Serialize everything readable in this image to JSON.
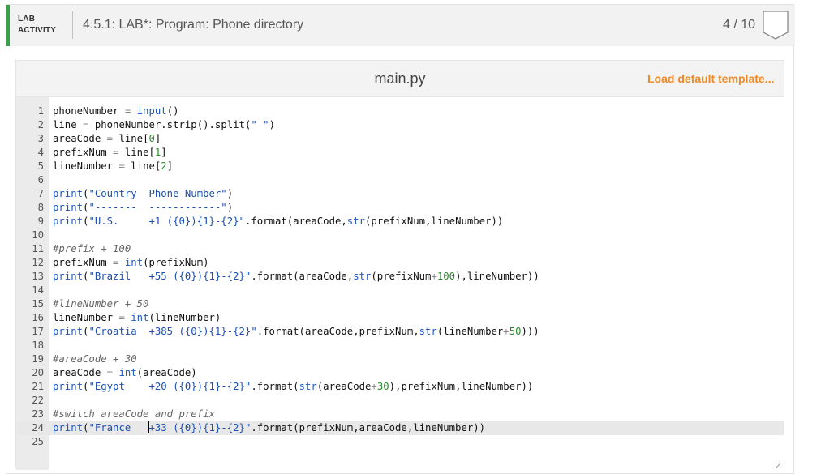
{
  "lab": {
    "tag_line1": "LAB",
    "tag_line2": "ACTIVITY",
    "title": "4.5.1: LAB*: Program: Phone directory",
    "score": "4 / 10",
    "accent_color": "#3a9e4a"
  },
  "editor": {
    "file_name": "main.py",
    "load_template_label": "Load default template...",
    "load_template_color": "#f08a24",
    "active_line": 24,
    "lines": [
      {
        "n": "1",
        "t": [
          [
            "var",
            "phoneNumber"
          ],
          [
            "op",
            " = "
          ],
          [
            "kw",
            "input"
          ],
          [
            "pun",
            "()"
          ]
        ]
      },
      {
        "n": "2",
        "t": [
          [
            "var",
            "line"
          ],
          [
            "op",
            " = "
          ],
          [
            "var",
            "phoneNumber.strip().split("
          ],
          [
            "str",
            "\" \""
          ],
          [
            "pun",
            ")"
          ]
        ]
      },
      {
        "n": "3",
        "t": [
          [
            "var",
            "areaCode"
          ],
          [
            "op",
            " = "
          ],
          [
            "var",
            "line["
          ],
          [
            "num",
            "0"
          ],
          [
            "pun",
            "]"
          ]
        ]
      },
      {
        "n": "4",
        "t": [
          [
            "var",
            "prefixNum"
          ],
          [
            "op",
            " = "
          ],
          [
            "var",
            "line["
          ],
          [
            "num",
            "1"
          ],
          [
            "pun",
            "]"
          ]
        ]
      },
      {
        "n": "5",
        "t": [
          [
            "var",
            "lineNumber"
          ],
          [
            "op",
            " = "
          ],
          [
            "var",
            "line["
          ],
          [
            "num",
            "2"
          ],
          [
            "pun",
            "]"
          ]
        ]
      },
      {
        "n": "6",
        "t": []
      },
      {
        "n": "7",
        "t": [
          [
            "kw",
            "print"
          ],
          [
            "pun",
            "("
          ],
          [
            "str",
            "\"Country  Phone Number\""
          ],
          [
            "pun",
            ")"
          ]
        ]
      },
      {
        "n": "8",
        "t": [
          [
            "kw",
            "print"
          ],
          [
            "pun",
            "("
          ],
          [
            "str",
            "\"-------  ------------\""
          ],
          [
            "pun",
            ")"
          ]
        ]
      },
      {
        "n": "9",
        "t": [
          [
            "kw",
            "print"
          ],
          [
            "pun",
            "("
          ],
          [
            "str",
            "\"U.S.     +1 ({0}){1}-{2}\""
          ],
          [
            "pun",
            ".format(areaCode,"
          ],
          [
            "kw",
            "str"
          ],
          [
            "pun",
            "(prefixNum,lineNumber))"
          ]
        ]
      },
      {
        "n": "10",
        "t": []
      },
      {
        "n": "11",
        "t": [
          [
            "cm",
            "#prefix + 100"
          ]
        ]
      },
      {
        "n": "12",
        "t": [
          [
            "var",
            "prefixNum"
          ],
          [
            "op",
            " = "
          ],
          [
            "kw",
            "int"
          ],
          [
            "pun",
            "(prefixNum)"
          ]
        ]
      },
      {
        "n": "13",
        "t": [
          [
            "kw",
            "print"
          ],
          [
            "pun",
            "("
          ],
          [
            "str",
            "\"Brazil   +55 ({0}){1}-{2}\""
          ],
          [
            "pun",
            ".format(areaCode,"
          ],
          [
            "kw",
            "str"
          ],
          [
            "pun",
            "(prefixNum"
          ],
          [
            "op",
            "+"
          ],
          [
            "num",
            "100"
          ],
          [
            "pun",
            "),lineNumber))"
          ]
        ]
      },
      {
        "n": "14",
        "t": []
      },
      {
        "n": "15",
        "t": [
          [
            "cm",
            "#lineNumber + 50"
          ]
        ]
      },
      {
        "n": "16",
        "t": [
          [
            "var",
            "lineNumber"
          ],
          [
            "op",
            " = "
          ],
          [
            "kw",
            "int"
          ],
          [
            "pun",
            "(lineNumber)"
          ]
        ]
      },
      {
        "n": "17",
        "t": [
          [
            "kw",
            "print"
          ],
          [
            "pun",
            "("
          ],
          [
            "str",
            "\"Croatia  +385 ({0}){1}-{2}\""
          ],
          [
            "pun",
            ".format(areaCode,prefixNum,"
          ],
          [
            "kw",
            "str"
          ],
          [
            "pun",
            "(lineNumber"
          ],
          [
            "op",
            "+"
          ],
          [
            "num",
            "50"
          ],
          [
            "pun",
            ")))"
          ]
        ]
      },
      {
        "n": "18",
        "t": []
      },
      {
        "n": "19",
        "t": [
          [
            "cm",
            "#areaCode + 30"
          ]
        ]
      },
      {
        "n": "20",
        "t": [
          [
            "var",
            "areaCode"
          ],
          [
            "op",
            " = "
          ],
          [
            "kw",
            "int"
          ],
          [
            "pun",
            "(areaCode)"
          ]
        ]
      },
      {
        "n": "21",
        "t": [
          [
            "kw",
            "print"
          ],
          [
            "pun",
            "("
          ],
          [
            "str",
            "\"Egypt    +20 ({0}){1}-{2}\""
          ],
          [
            "pun",
            ".format("
          ],
          [
            "kw",
            "str"
          ],
          [
            "pun",
            "(areaCode"
          ],
          [
            "op",
            "+"
          ],
          [
            "num",
            "30"
          ],
          [
            "pun",
            "),prefixNum,lineNumber))"
          ]
        ]
      },
      {
        "n": "22",
        "t": []
      },
      {
        "n": "23",
        "t": [
          [
            "cm",
            "#switch areaCode and prefix"
          ]
        ]
      },
      {
        "n": "24",
        "t": [
          [
            "kw",
            "print"
          ],
          [
            "pun",
            "("
          ],
          [
            "str",
            "\"France   "
          ],
          [
            "cursor",
            ""
          ],
          [
            "str",
            "+33 ({0}){1}-{2}\""
          ],
          [
            "pun",
            ".format(prefixNum,areaCode,lineNumber))"
          ]
        ]
      },
      {
        "n": "25",
        "t": []
      }
    ]
  }
}
